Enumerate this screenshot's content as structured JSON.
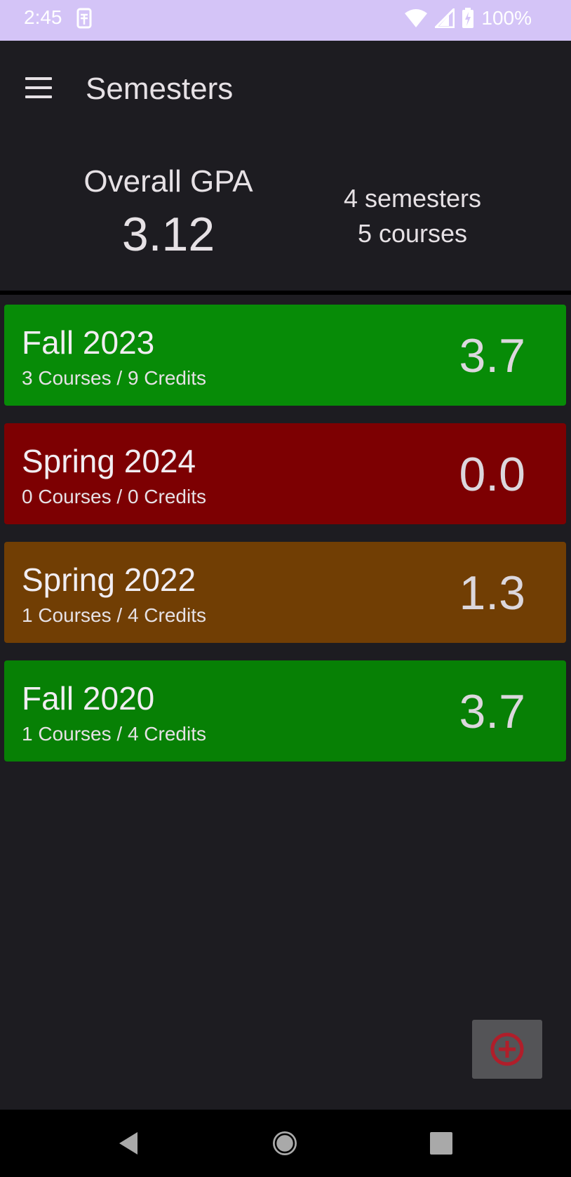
{
  "status_bar": {
    "time": "2:45",
    "battery": "100%",
    "background_color": "#d4c4f7"
  },
  "app_bar": {
    "title": "Semesters",
    "menu_icon": "menu-icon"
  },
  "summary": {
    "gpa_label": "Overall GPA",
    "gpa_value": "3.12",
    "semesters_count": "4 semesters",
    "courses_count": "5 courses"
  },
  "semesters": [
    {
      "name": "Fall 2023",
      "meta": "3 Courses / 9 Credits",
      "gpa": "3.7",
      "color": "#078b07"
    },
    {
      "name": "Spring 2024",
      "meta": "0 Courses / 0 Credits",
      "gpa": "0.0",
      "color": "#7d0002"
    },
    {
      "name": "Spring 2022",
      "meta": "1 Courses / 4 Credits",
      "gpa": "1.3",
      "color": "#713e04"
    },
    {
      "name": "Fall 2020",
      "meta": "1 Courses / 4 Credits",
      "gpa": "3.7",
      "color": "#078005"
    }
  ],
  "fab": {
    "icon": "add-circle-icon",
    "icon_color": "#b01e2a"
  },
  "nav": {
    "back_icon": "back-icon",
    "home_icon": "home-icon",
    "recents_icon": "recents-icon"
  }
}
